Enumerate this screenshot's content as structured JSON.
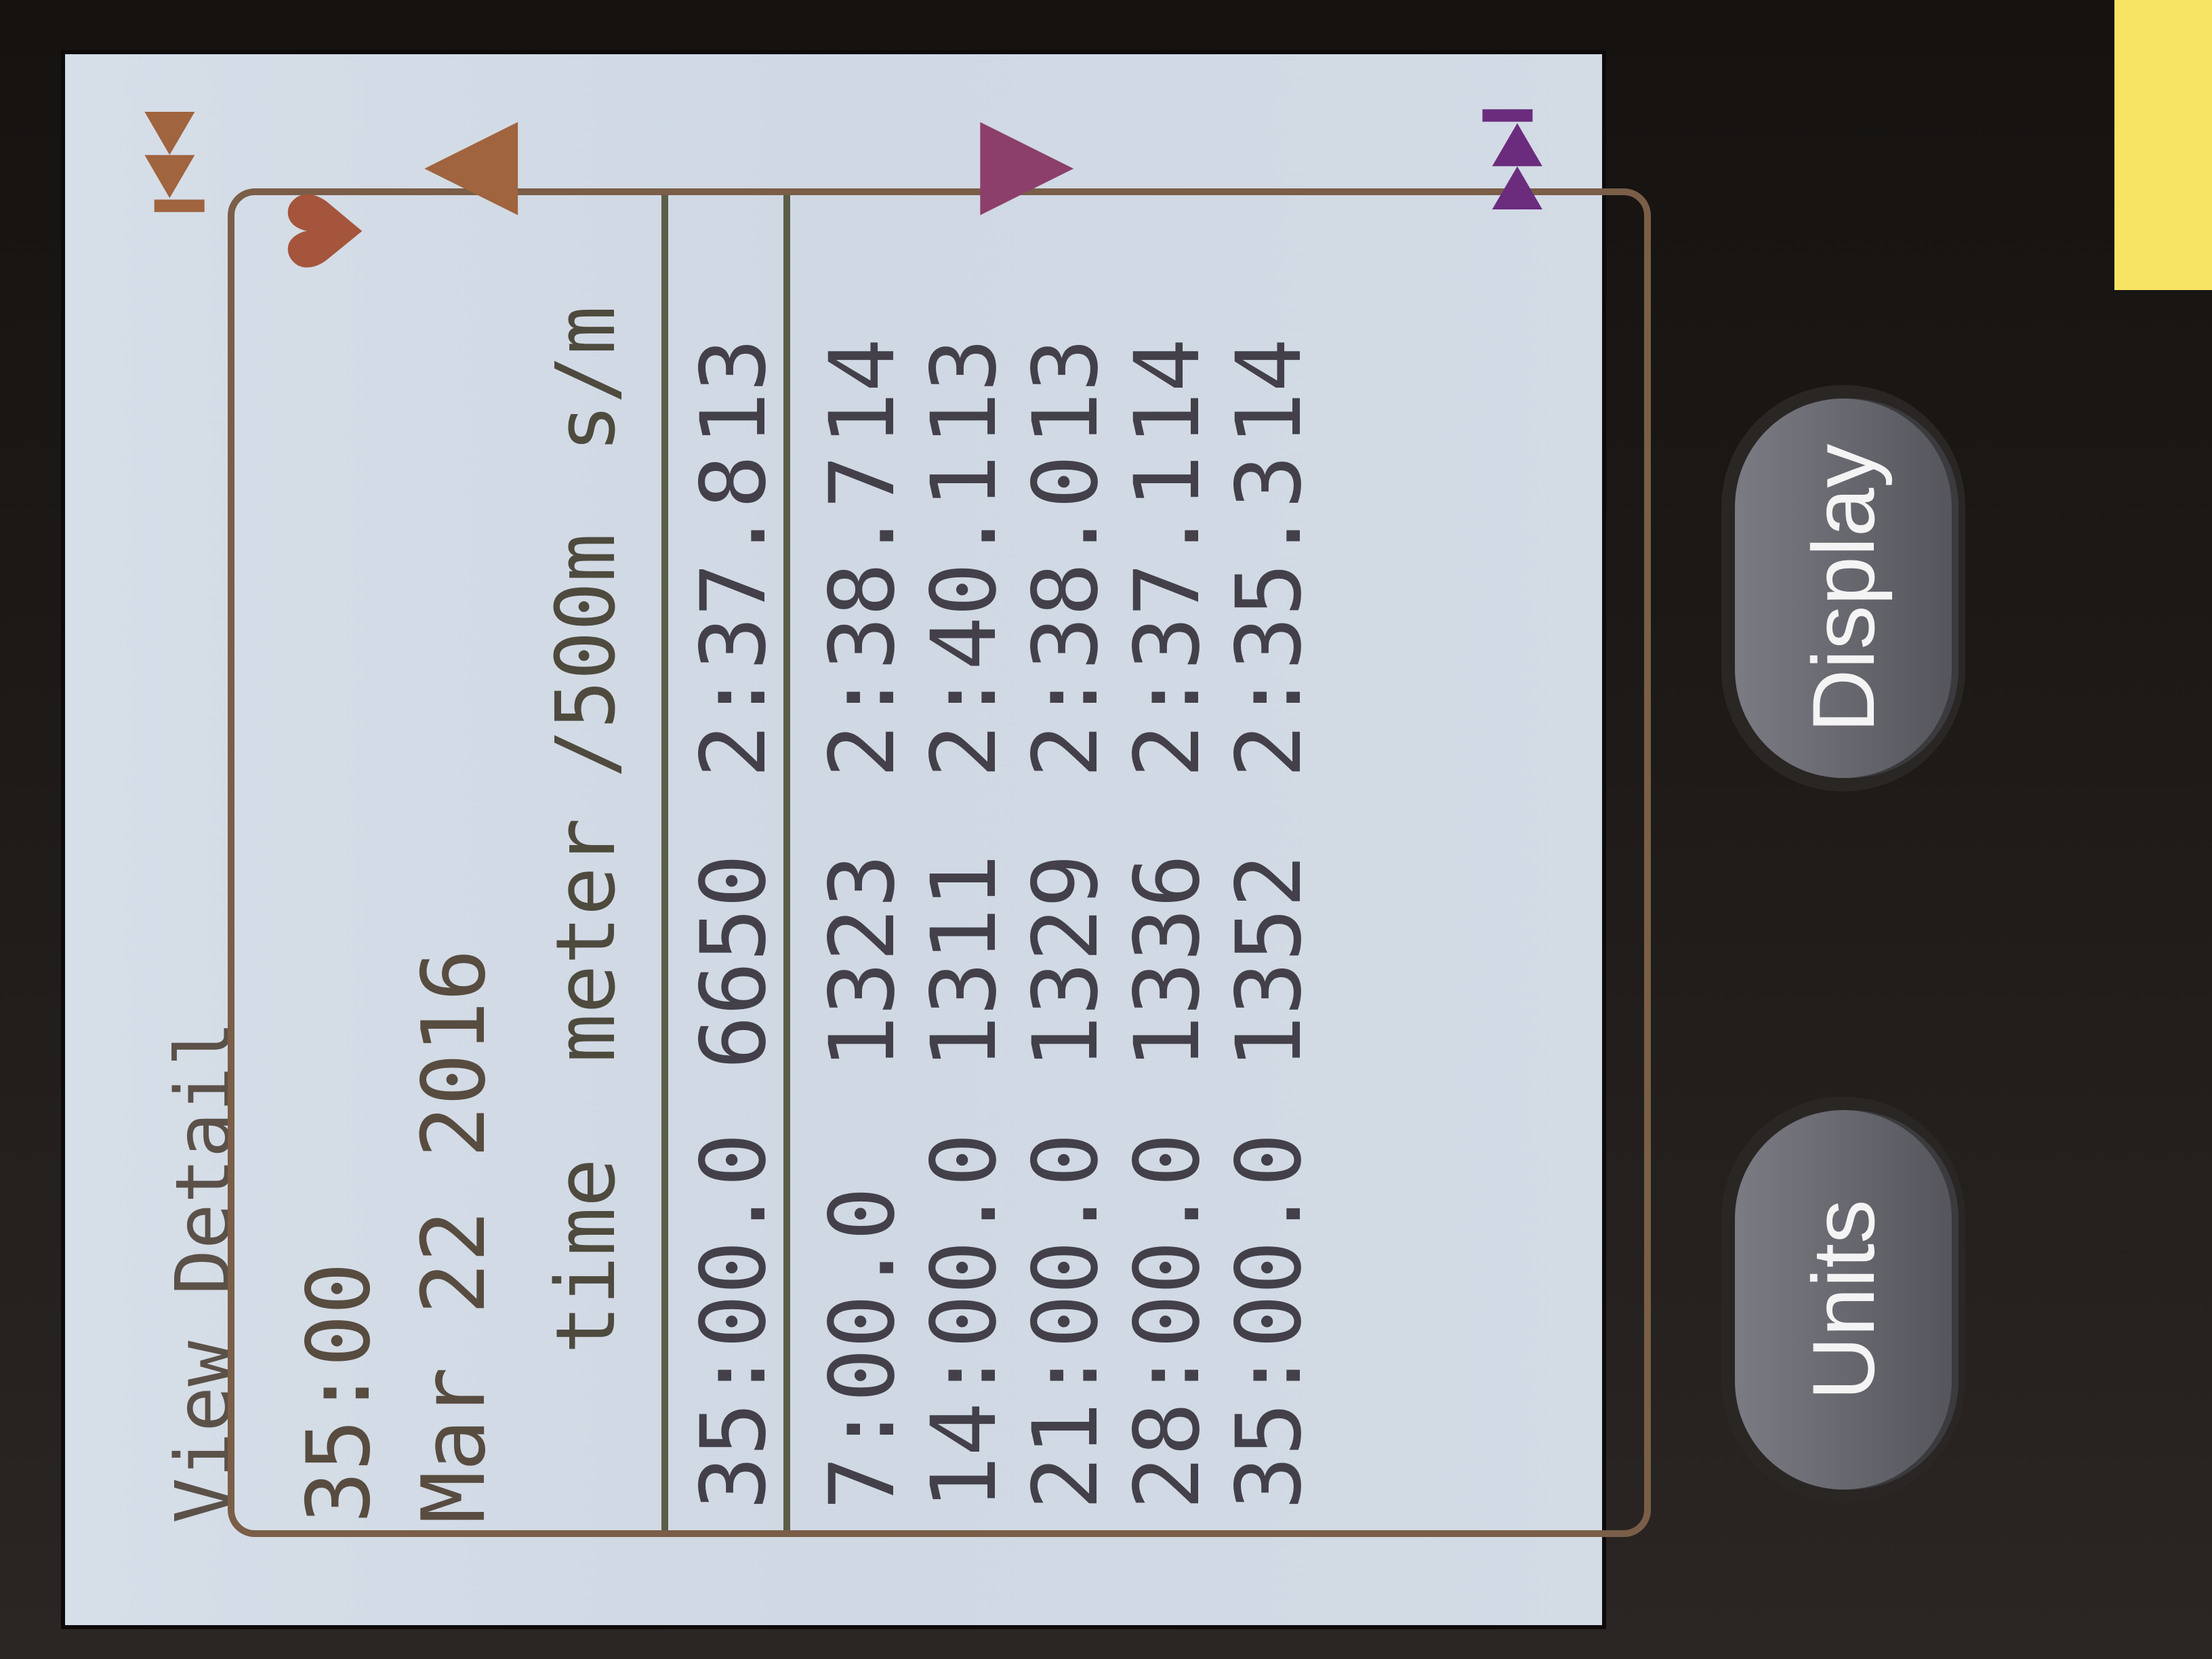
{
  "screen": {
    "title": "View Detail",
    "total_time": "35:00",
    "date": "Mar  22 2016"
  },
  "table": {
    "headers": {
      "time": "time",
      "meter": "meter",
      "split": "/500m",
      "rate": "s/m"
    },
    "summary": {
      "time": "35:00.0",
      "meter": "6650",
      "split": "2:37.8",
      "rate": "13"
    },
    "rows": [
      {
        "time": "7:00.0",
        "meter": "1323",
        "split": "2:38.7",
        "rate": "14"
      },
      {
        "time": "14:00.0",
        "meter": "1311",
        "split": "2:40.1",
        "rate": "13"
      },
      {
        "time": "21:00.0",
        "meter": "1329",
        "split": "2:38.0",
        "rate": "13"
      },
      {
        "time": "28:00.0",
        "meter": "1336",
        "split": "2:37.1",
        "rate": "14"
      },
      {
        "time": "35:00.0",
        "meter": "1352",
        "split": "2:35.3",
        "rate": "14"
      }
    ]
  },
  "icons": [
    "page-first-icon",
    "page-prev-icon",
    "page-next-icon",
    "page-last-icon",
    "heart-icon"
  ],
  "buttons": {
    "units": "Units",
    "display": "Display"
  },
  "colors": {
    "lcd_bg": "#d3dbe5",
    "text": "#3a3a46",
    "accent_brown": "#a0643e",
    "accent_purple": "#6b2c7e"
  }
}
